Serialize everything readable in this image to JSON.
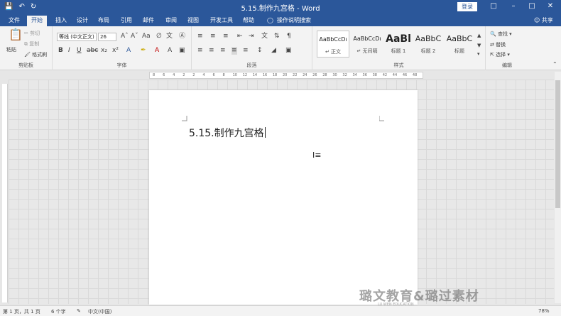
{
  "window": {
    "title": "5.15.制作九宫格 - Word",
    "login_label": "登录"
  },
  "qat": {
    "save_icon": "save-icon",
    "undo_icon": "undo-icon",
    "redo_icon": "redo-icon"
  },
  "tabs": [
    {
      "label": "文件"
    },
    {
      "label": "开始"
    },
    {
      "label": "插入"
    },
    {
      "label": "设计"
    },
    {
      "label": "布局"
    },
    {
      "label": "引用"
    },
    {
      "label": "邮件"
    },
    {
      "label": "审阅"
    },
    {
      "label": "视图"
    },
    {
      "label": "开发工具"
    },
    {
      "label": "帮助"
    },
    {
      "label": "操作说明搜索"
    }
  ],
  "share_label": "共享",
  "clipboard": {
    "paste_label": "粘贴",
    "cut_label": "剪切",
    "copy_label": "复制",
    "format_painter_label": "格式刷",
    "group_label": "剪贴板"
  },
  "font": {
    "font_name": "等线 (中文正文)",
    "font_size": "26",
    "group_label": "字体"
  },
  "paragraph": {
    "group_label": "段落"
  },
  "styles": {
    "items": [
      {
        "preview": "AaBbCcDı",
        "name": "↵ 正文"
      },
      {
        "preview": "AaBbCcDı",
        "name": "↵ 无间隔"
      },
      {
        "preview": "AaBl",
        "name": "标题 1"
      },
      {
        "preview": "AaBbC",
        "name": "标题 2"
      },
      {
        "preview": "AaBbC",
        "name": "标题"
      }
    ],
    "group_label": "样式"
  },
  "editing": {
    "find_label": "查找",
    "replace_label": "替换",
    "select_label": "选择",
    "group_label": "编辑"
  },
  "ruler": {
    "ticks": [
      "8",
      "6",
      "4",
      "2",
      "2",
      "4",
      "6",
      "8",
      "10",
      "12",
      "14",
      "16",
      "18",
      "20",
      "22",
      "24",
      "26",
      "28",
      "30",
      "32",
      "34",
      "36",
      "38",
      "42",
      "44",
      "46",
      "48"
    ]
  },
  "document": {
    "text": "5.15.制作九宫格"
  },
  "status": {
    "page": "第 1 页，共 1 页",
    "words": "6 个字",
    "language": "中文(中国)",
    "zoom": "78%"
  },
  "watermark": {
    "text": "璐文教育&璐过素材",
    "sub": "LU WEN EDUCATION"
  }
}
